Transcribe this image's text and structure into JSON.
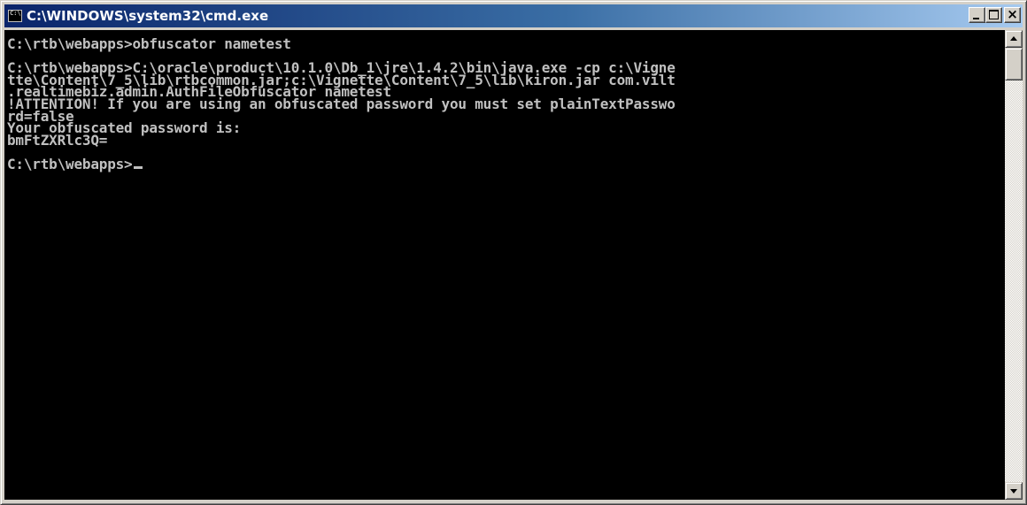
{
  "window": {
    "title": "C:\\WINDOWS\\system32\\cmd.exe",
    "app_icon": "cmd-icon",
    "controls": {
      "minimize_icon": "minimize-icon",
      "maximize_icon": "maximize-icon",
      "close_icon": "close-icon"
    }
  },
  "console": {
    "background_color": "#000000",
    "text_color": "#c0c0c0",
    "lines": [
      "C:\\rtb\\webapps>obfuscator nametest",
      "",
      "C:\\rtb\\webapps>C:\\oracle\\product\\10.1.0\\Db_1\\jre\\1.4.2\\bin\\java.exe -cp c:\\Vigne",
      "tte\\Content\\7_5\\lib\\rtbcommon.jar;c:\\Vignette\\Content\\7_5\\lib\\kiron.jar com.vilt",
      ".realtimebiz.admin.AuthFileObfuscator nametest",
      "!ATTENTION! If you are using an obfuscated password you must set plainTextPasswo",
      "rd=false",
      "Your obfuscated password is:",
      "bmFtZXRlc3Q=",
      ""
    ],
    "prompt": "C:\\rtb\\webapps>"
  },
  "scrollbar": {
    "up_icon": "scroll-up-arrow-icon",
    "down_icon": "scroll-down-arrow-icon"
  }
}
